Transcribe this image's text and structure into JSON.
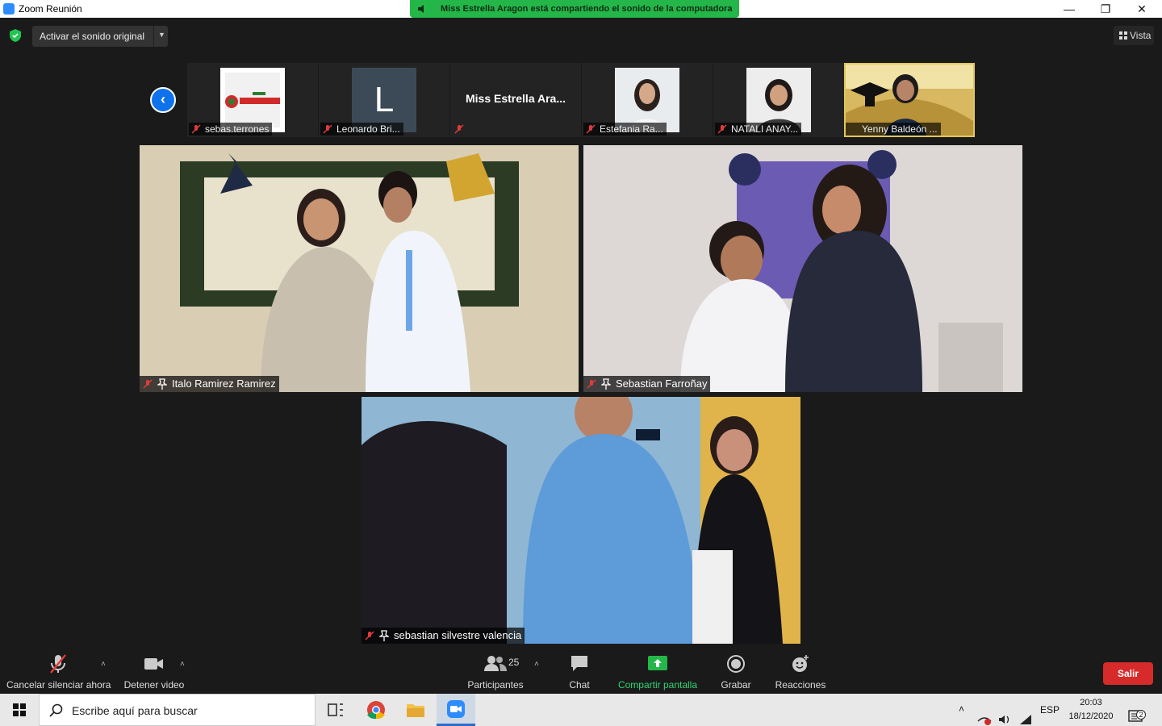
{
  "window": {
    "title": "Zoom Reunión",
    "minimize": "—",
    "restore": "❐",
    "close": "✕"
  },
  "share_banner": "Miss Estrella Aragon está compartiendo el sonido de la computadora",
  "topbar": {
    "original_sound": "Activar el sonido original",
    "view": "Vista"
  },
  "thumbnails": [
    {
      "name": "sebas.terrones"
    },
    {
      "name": "Leonardo Bri...",
      "initial": "L"
    },
    {
      "name": "",
      "display": "Miss Estrella Ara..."
    },
    {
      "name": "Estefania Ra..."
    },
    {
      "name": "NATALI ANAY..."
    },
    {
      "name": "Yenny Baldeón ..."
    }
  ],
  "tiles": [
    {
      "name": "Italo Ramirez Ramirez"
    },
    {
      "name": "Sebastian Farroñay"
    },
    {
      "name": "sebastian silvestre valencia"
    }
  ],
  "toolbar": {
    "unmute": "Cancelar silenciar ahora",
    "stop_video": "Detener video",
    "participants": "Participantes",
    "participants_count": "25",
    "chat": "Chat",
    "share": "Compartir pantalla",
    "record": "Grabar",
    "reactions": "Reacciones",
    "leave": "Salir"
  },
  "taskbar": {
    "search_placeholder": "Escribe aquí para buscar",
    "language": "ESP",
    "time": "20:03",
    "date": "18/12/2020",
    "notifications": "2"
  },
  "colors": {
    "zoom_blue": "#0e72ed",
    "share_green": "#25b64a",
    "leave_red": "#d72b2b",
    "active_speaker": "#e1c75a"
  }
}
